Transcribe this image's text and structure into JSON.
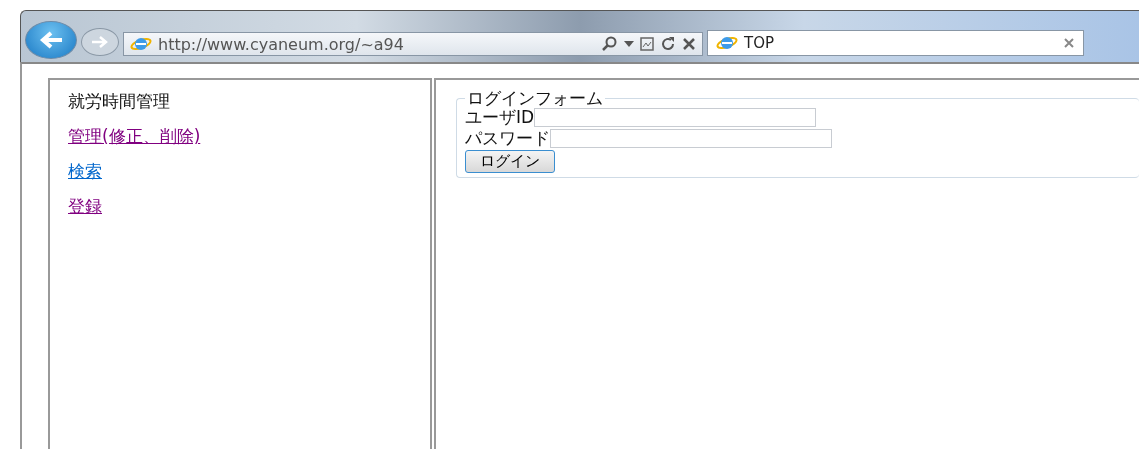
{
  "browser": {
    "address": "http://www.cyaneum.org/~a94",
    "tab_title": "TOP"
  },
  "sidebar": {
    "title": "就労時間管理",
    "links": [
      {
        "label": "管理(修正、削除)",
        "visited": true
      },
      {
        "label": "検索",
        "visited": false
      },
      {
        "label": "登録",
        "visited": true
      }
    ]
  },
  "login_form": {
    "legend": "ログインフォーム",
    "user_label": "ユーザID",
    "password_label": "パスワード",
    "button": "ログイン"
  }
}
